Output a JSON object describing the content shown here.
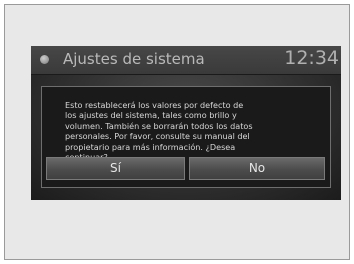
{
  "header": {
    "title": "Ajustes de sistema",
    "clock": "12:34",
    "status_icon": "circle-indicator-icon"
  },
  "dialog": {
    "message": "Esto restablecerá los valores por defecto de\nlos ajustes del sistema, tales como brillo y\nvolumen. También se borrarán todos los datos\npersonales. Por favor, consulte su manual del\npropietario para más información. ¿Desea\ncontinuar?",
    "yes_label": "Sí",
    "no_label": "No"
  },
  "colors": {
    "screen_background": "#303030",
    "dialog_background": "#1a1a1a",
    "button_background": "#555555",
    "text": "#d8d8d8"
  }
}
